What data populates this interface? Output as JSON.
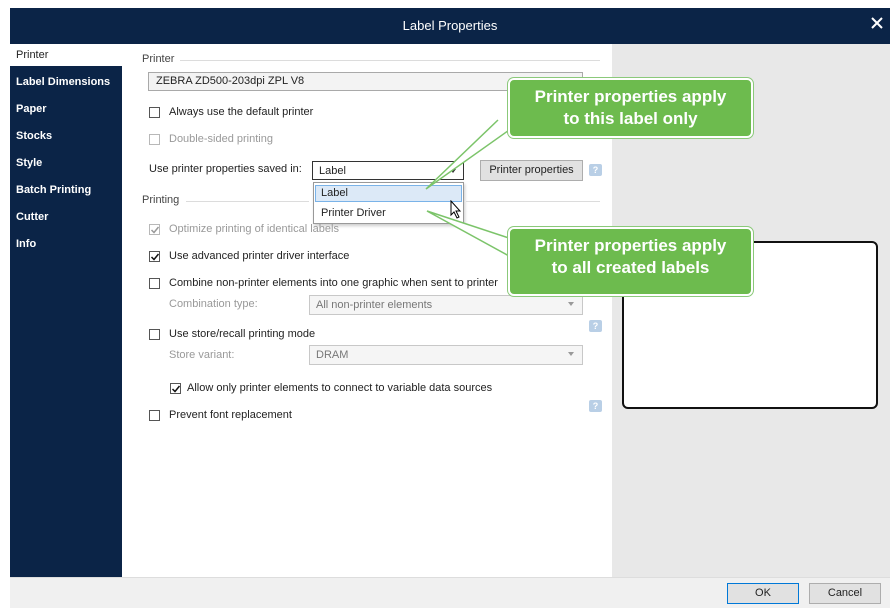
{
  "window": {
    "title": "Label Properties"
  },
  "sidebar": {
    "items": [
      {
        "label": "Printer"
      },
      {
        "label": "Label Dimensions"
      },
      {
        "label": "Paper"
      },
      {
        "label": "Stocks"
      },
      {
        "label": "Style"
      },
      {
        "label": "Batch Printing"
      },
      {
        "label": "Cutter"
      },
      {
        "label": "Info"
      }
    ]
  },
  "printer_section": {
    "title": "Printer",
    "printer_name": "ZEBRA ZD500-203dpi ZPL V8",
    "always_default": "Always use the default printer",
    "double_sided": "Double-sided printing",
    "saved_in_label": "Use printer properties saved in:",
    "saved_in_value": "Label",
    "printer_properties_button": "Printer properties",
    "dropdown_options": [
      "Label",
      "Printer Driver"
    ]
  },
  "printing_section": {
    "title": "Printing",
    "optimize": "Optimize printing of identical labels",
    "advanced_driver": "Use advanced printer driver interface",
    "combine": "Combine non-printer elements into one graphic when sent to printer",
    "combination_type_label": "Combination type:",
    "combination_type_value": "All non-printer elements",
    "store_recall": "Use store/recall printing mode",
    "store_variant_label": "Store variant:",
    "store_variant_value": "DRAM",
    "allow_only": "Allow only printer elements to connect to variable data sources",
    "prevent_font": "Prevent font replacement"
  },
  "callouts": {
    "label_only": [
      "Printer properties apply",
      "to this label only"
    ],
    "all_labels": [
      "Printer properties apply",
      "to all created labels"
    ]
  },
  "footer": {
    "ok": "OK",
    "cancel": "Cancel"
  }
}
